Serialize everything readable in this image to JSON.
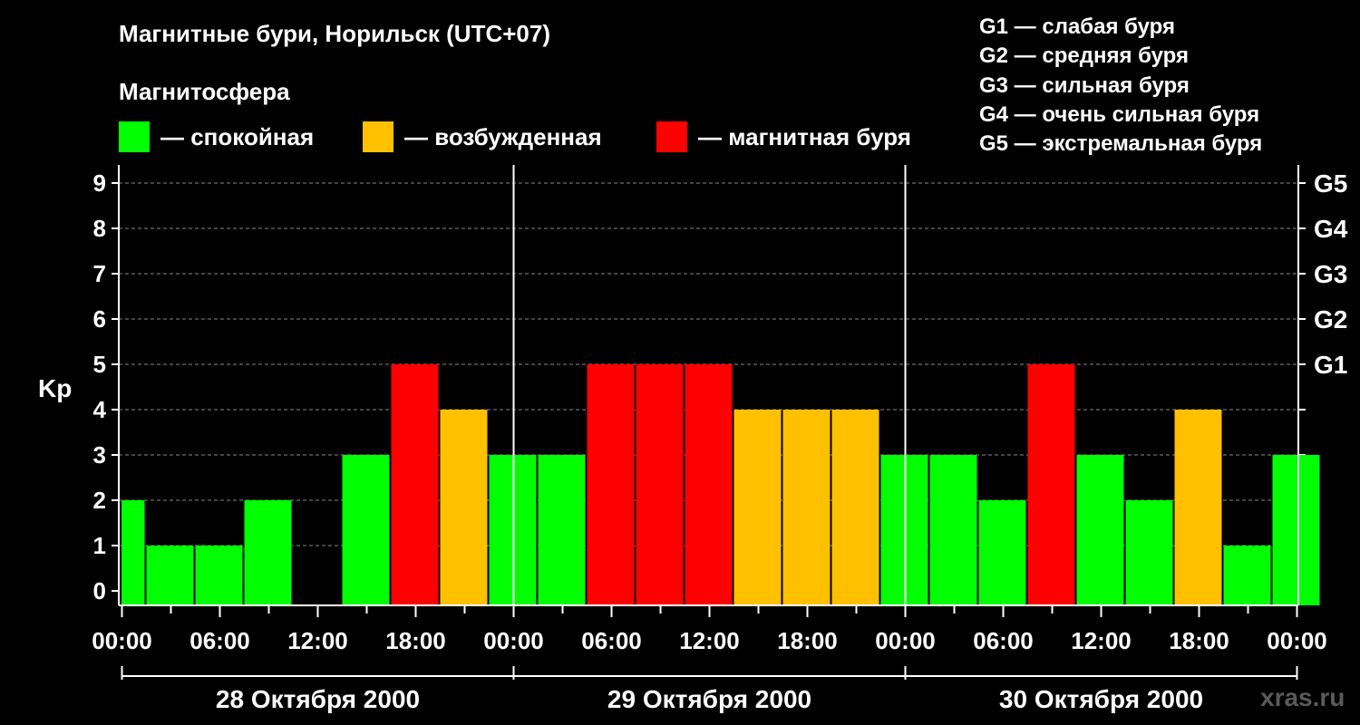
{
  "title": "Магнитные бури, Норильск (UTC+07)",
  "subtitle": "Магнитосфера",
  "legend": [
    {
      "label": "— спокойная",
      "color": "#00ff00"
    },
    {
      "label": "— возбужденная",
      "color": "#ffc000"
    },
    {
      "label": "— магнитная буря",
      "color": "#ff0000"
    }
  ],
  "g_legend": [
    "G1 — слабая буря",
    "G2 — средняя буря",
    "G3 — сильная буря",
    "G4 — очень сильная буря",
    "G5 — экстремальная буря"
  ],
  "watermark": "xras.ru",
  "chart_data": {
    "type": "bar",
    "ylabel": "Kp",
    "ylim": [
      0,
      9
    ],
    "yticks": [
      "0",
      "1",
      "2",
      "3",
      "4",
      "5",
      "6",
      "7",
      "8",
      "9"
    ],
    "right_ticks": [
      {
        "kp": 5,
        "label": "G1"
      },
      {
        "kp": 6,
        "label": "G2"
      },
      {
        "kp": 7,
        "label": "G3"
      },
      {
        "kp": 8,
        "label": "G4"
      },
      {
        "kp": 9,
        "label": "G5"
      }
    ],
    "xticks": [
      "00:00",
      "06:00",
      "12:00",
      "18:00",
      "00:00",
      "06:00",
      "12:00",
      "18:00",
      "00:00",
      "06:00",
      "12:00",
      "18:00",
      "00:00"
    ],
    "days": [
      "28 Октября 2000",
      "29 Октября 2000",
      "30 Октября 2000"
    ],
    "grid": "horizontal dashed",
    "bar_width_hours": 3,
    "x_start_hour": -1.5,
    "x_end_hour": 72,
    "bars": [
      {
        "start_hour": -1.5,
        "kp": 2,
        "level": "calm"
      },
      {
        "start_hour": 1.5,
        "kp": 1,
        "level": "calm"
      },
      {
        "start_hour": 4.5,
        "kp": 1,
        "level": "calm"
      },
      {
        "start_hour": 7.5,
        "kp": 2,
        "level": "calm"
      },
      {
        "start_hour": 10.5,
        "kp": 0,
        "level": "calm"
      },
      {
        "start_hour": 13.5,
        "kp": 3,
        "level": "calm"
      },
      {
        "start_hour": 16.5,
        "kp": 5,
        "level": "storm"
      },
      {
        "start_hour": 19.5,
        "kp": 4,
        "level": "excited"
      },
      {
        "start_hour": 22.5,
        "kp": 3,
        "level": "calm"
      },
      {
        "start_hour": 25.5,
        "kp": 3,
        "level": "calm"
      },
      {
        "start_hour": 28.5,
        "kp": 5,
        "level": "storm"
      },
      {
        "start_hour": 31.5,
        "kp": 5,
        "level": "storm"
      },
      {
        "start_hour": 34.5,
        "kp": 5,
        "level": "storm"
      },
      {
        "start_hour": 37.5,
        "kp": 4,
        "level": "excited"
      },
      {
        "start_hour": 40.5,
        "kp": 4,
        "level": "excited"
      },
      {
        "start_hour": 43.5,
        "kp": 4,
        "level": "excited"
      },
      {
        "start_hour": 46.5,
        "kp": 3,
        "level": "calm"
      },
      {
        "start_hour": 49.5,
        "kp": 3,
        "level": "calm"
      },
      {
        "start_hour": 52.5,
        "kp": 2,
        "level": "calm"
      },
      {
        "start_hour": 55.5,
        "kp": 5,
        "level": "storm"
      },
      {
        "start_hour": 58.5,
        "kp": 3,
        "level": "calm"
      },
      {
        "start_hour": 61.5,
        "kp": 2,
        "level": "calm"
      },
      {
        "start_hour": 64.5,
        "kp": 4,
        "level": "excited"
      },
      {
        "start_hour": 67.5,
        "kp": 1,
        "level": "calm"
      },
      {
        "start_hour": 70.5,
        "kp": 3,
        "level": "calm"
      }
    ],
    "level_colors": {
      "calm": "#00ff00",
      "excited": "#ffc000",
      "storm": "#ff0000"
    }
  }
}
